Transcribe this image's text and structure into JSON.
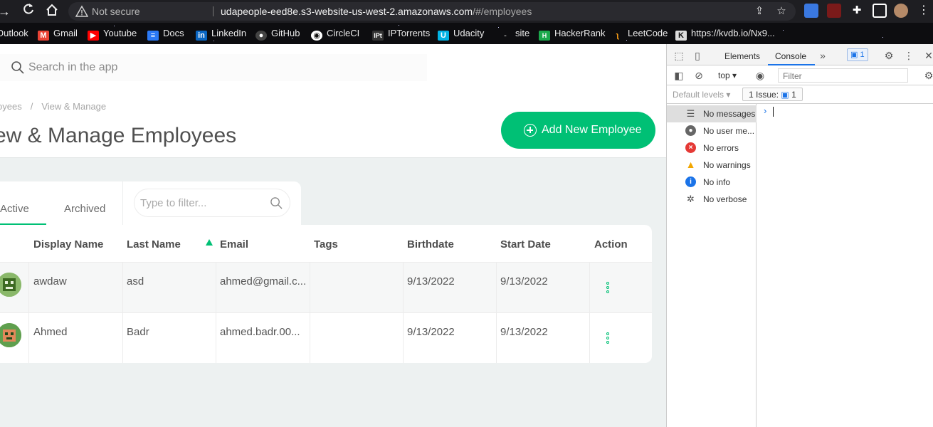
{
  "browser": {
    "not_secure": "Not secure",
    "url_host": "udapeople-eed8e.s3-website-us-west-2.amazonaws.com",
    "url_path": "/#/employees",
    "bookmarks": [
      {
        "label": "Outlook",
        "icon": "outlook-icon",
        "color": "#0a64d8"
      },
      {
        "label": "Gmail",
        "icon": "gmail-icon",
        "color": "#ea4335"
      },
      {
        "label": "Youtube",
        "icon": "youtube-icon",
        "color": "#ff0000"
      },
      {
        "label": "Docs",
        "icon": "docs-icon",
        "color": "#2b79f5"
      },
      {
        "label": "LinkedIn",
        "icon": "linkedin-icon",
        "color": "#0a66c2"
      },
      {
        "label": "GitHub",
        "icon": "github-icon",
        "color": "#444444"
      },
      {
        "label": "CircleCI",
        "icon": "circleci-icon",
        "color": "#ffffff"
      },
      {
        "label": "IPTorrents",
        "icon": "iptorrents-icon",
        "color": "#333333"
      },
      {
        "label": "Udacity",
        "icon": "udacity-icon",
        "color": "#02b3e4"
      },
      {
        "label": "site",
        "icon": "site-icon",
        "color": "#777777"
      },
      {
        "label": "HackerRank",
        "icon": "hackerrank-icon",
        "color": "#1ba94c"
      },
      {
        "label": "LeetCode",
        "icon": "leetcode-icon",
        "color": "#ffa116"
      },
      {
        "label": "https://kvdb.io/Nx9...",
        "icon": "kvdb-icon",
        "color": "#dddddd"
      }
    ]
  },
  "app": {
    "search_placeholder": "Search in the app",
    "breadcrumb": {
      "parent": "oyees",
      "current": "View & Manage"
    },
    "title": "ew & Manage Employees",
    "add_button": "Add New Employee",
    "tabs": {
      "active": "Active",
      "archived": "Archived"
    },
    "filter_placeholder": "Type to filter...",
    "columns": [
      "Display Name",
      "Last Name",
      "Email",
      "Tags",
      "Birthdate",
      "Start Date",
      "Action"
    ],
    "rows": [
      {
        "display_name": "awdaw",
        "last_name": "asd",
        "email": "ahmed@gmail.c...",
        "tags": "",
        "birthdate": "9/13/2022",
        "start_date": "9/13/2022"
      },
      {
        "display_name": "Ahmed",
        "last_name": "Badr",
        "email": "ahmed.badr.00...",
        "tags": "",
        "birthdate": "9/13/2022",
        "start_date": "9/13/2022"
      }
    ],
    "accent_color": "#00c075"
  },
  "devtools": {
    "tabs": {
      "elements": "Elements",
      "console": "Console"
    },
    "issues_badge": "1",
    "context": "top",
    "filter_placeholder": "Filter",
    "default_levels": "Default levels",
    "issue_label": "1 Issue:",
    "issue_count": "1",
    "sidebar": [
      {
        "label": "No messages",
        "icon": "list-icon"
      },
      {
        "label": "No user me...",
        "icon": "user-icon"
      },
      {
        "label": "No errors",
        "icon": "error-icon"
      },
      {
        "label": "No warnings",
        "icon": "warning-icon"
      },
      {
        "label": "No info",
        "icon": "info-icon"
      },
      {
        "label": "No verbose",
        "icon": "verbose-icon"
      }
    ]
  }
}
